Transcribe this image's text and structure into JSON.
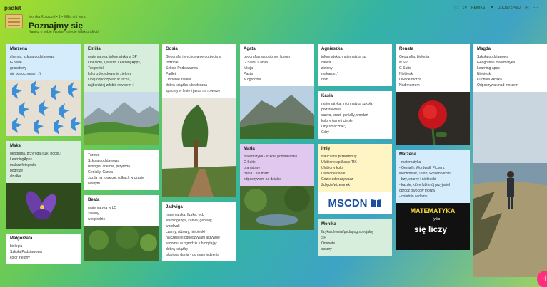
{
  "app": {
    "logo": "padlet"
  },
  "header": {
    "breadcrumb": "Monika Koszczol • 1 • Kilka dni temu",
    "title": "Poznajmy się",
    "subtitle": "Napisz o sobie i wstaw zdjęcie (mak grafika)"
  },
  "toolbar": {
    "remix_label": "REMIKS",
    "share_label": "UDOSTĘPNIJ"
  },
  "columns": [
    {
      "cards": [
        {
          "name": "Marzena",
          "lines": [
            "chemia, szkoła podstawowa",
            "G Suite",
            "granatowy",
            "nic odpoczywam :-)"
          ]
        },
        {
          "name": "Maks",
          "lines": [
            "geografia, przyroda (szk. podst.)",
            "LearningApps",
            "malarz fotografia",
            "podróże",
            "działka"
          ]
        },
        {
          "name": "Małgorzata",
          "lines": [
            "biologia",
            "Szkoła Podstawowa",
            "kolor zielony"
          ]
        }
      ]
    },
    {
      "cards": [
        {
          "name": "Emilia",
          "lines": [
            "matematyka, informatyka w SP",
            "OneNote, Quizizz, LearningApps,",
            "Testportal,",
            "kolor zdecydowanie zielony",
            "lubię odpoczywać w ruchu,",
            "najbardziej zdobić rowerem :)"
          ]
        },
        {
          "name": "",
          "lines": [
            "Turowo",
            "Szkoła podstawowa",
            "Biologia, chemia, przyroda",
            "Genially, Canva",
            "Jazda na rowerze, rolkach w czasie",
            "wolnym"
          ]
        },
        {
          "name": "Beata",
          "lines": [
            "matematyka w LO",
            "zielony",
            "w ogrodzie"
          ]
        }
      ]
    },
    {
      "cards": [
        {
          "name": "Gosia",
          "lines": [
            "Geografia i wychowanie do życia w",
            "rodzinie",
            "Szkoła Podstawowa",
            "Padlet,",
            "Odcienie zieleni",
            "dobra książka lub włóczka",
            "spacery w lesie i jazda na rowerze"
          ]
        },
        {
          "name": "Jadwiga",
          "lines": [
            "matematyka, fizyka, ecb",
            "learningapps, canva, genially,",
            "wordwall",
            "czarny, różowy, niebieski",
            "najczęściej odpoczywam aktywnie",
            "w domu, w ogrodzie lub czytając",
            "dobrą książkę",
            "ulubiona dania - do mam jedzenia"
          ]
        }
      ]
    },
    {
      "cards": [
        {
          "name": "Agata",
          "lines": [
            "geografia na poziomie liceum",
            "G Suite, Canva",
            "fuksja",
            "Pasta",
            "w ogrodzie"
          ]
        },
        {
          "name": "Maria",
          "lines": [
            "matematyka - szkoła podstawowa",
            "G Suite",
            "granatowy",
            "dania - nie mam",
            "odpoczywam na działce"
          ]
        }
      ]
    },
    {
      "cards": [
        {
          "name": "Agnieszka",
          "lines": [
            "informatyka, matematyka sp",
            "canva",
            "zielony",
            "makaron :)",
            "dom"
          ]
        },
        {
          "name": "Kasia",
          "lines": [
            "matematyka, informatyka szkoła",
            "podstawowa",
            "canva, prezi, genially, wordart",
            "kolory jasne i ciepłe",
            "Oby smacznie:)",
            "Góry"
          ]
        },
        {
          "name": "Imię",
          "lines": [
            "Nauczany przedmiot/y",
            "Ulubione aplikacje TIK",
            "Ulubiony kolor",
            "Ulubione danie",
            "Gdzie odpoczywasz",
            "Zdjęcie/wizerunek"
          ],
          "logo_text": "MSCDN"
        },
        {
          "name": "Monika",
          "lines": [
            "fizyka/chemia/pedagog specjalny",
            "SP",
            "Onenote",
            "czarny"
          ]
        }
      ]
    },
    {
      "cards": [
        {
          "name": "Renata",
          "lines": [
            "Geografia, biologia",
            "w SP",
            "G Suite",
            "Niebieski",
            "Owoce morza",
            "Nad morzem"
          ]
        },
        {
          "name": "Marzena",
          "lines": [
            "- matematyka",
            "- Genially, Wordwall, Pickers,",
            "Mentimeter, Testo, Whiteboard fi",
            "- bzy, czarny i niebieski",
            "- kazde, które lubi mój przyjaciel",
            "oprócz owoców morza",
            "- ostatnio w domu"
          ],
          "image_text": [
            "MATEMATYKA",
            "tylko",
            "się liczy"
          ]
        }
      ]
    },
    {
      "cards": [
        {
          "name": "Magda",
          "lines": [
            "Szkoła podstawowa",
            "Geografia i matematyka",
            "Learning apps",
            "Niebieski",
            "Kuchnia włoska",
            "Odpoczywak nad morzem"
          ]
        }
      ]
    }
  ]
}
